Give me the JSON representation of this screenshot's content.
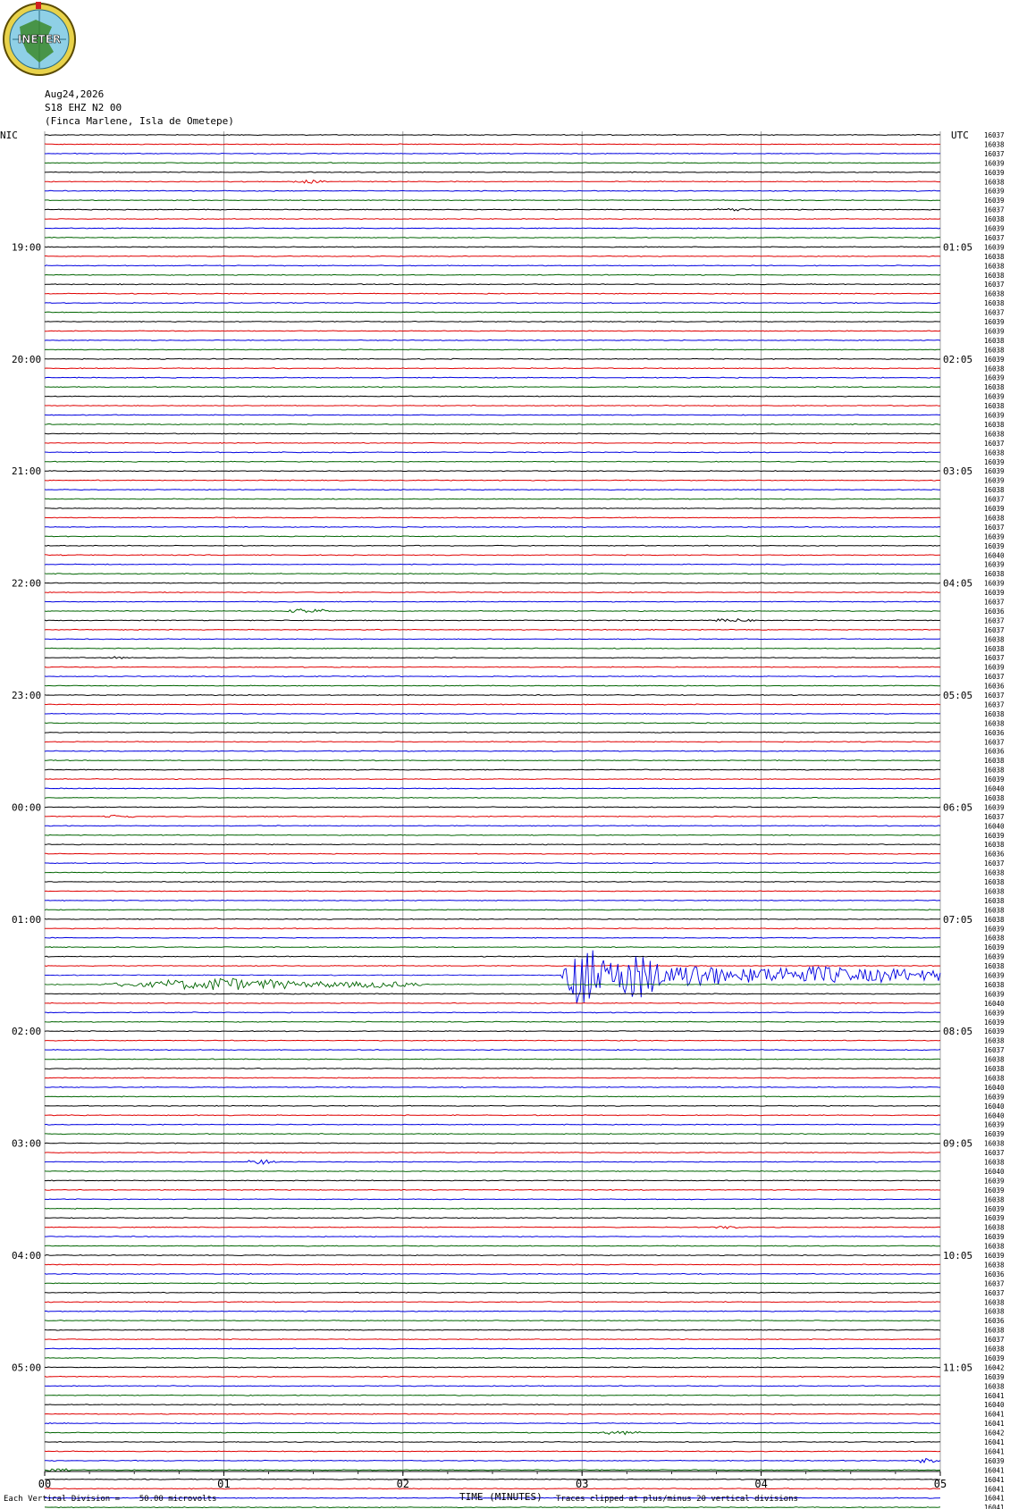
{
  "header": {
    "logo_text": "INETER",
    "date": "Aug24,2026",
    "station": "S18 EHZ N2 00",
    "location": "(Finca Marlene, Isla de Ometepe)"
  },
  "footer": {
    "scale_note": "Each Vertical Division =    50.00 microvolts",
    "axis_title": "TIME (MINUTES)",
    "clip_note": "Traces clipped at plus/minus 20 vertical divisions"
  },
  "colors": {
    "black": "#000000",
    "red": "#e00000",
    "blue": "#0000e0",
    "green": "#006400",
    "grid": "#8a8a8a"
  },
  "chart_data": {
    "type": "line",
    "title": "",
    "xlabel": "TIME (MINUTES)",
    "ylabel": "",
    "xlim": [
      0,
      5
    ],
    "x_ticks": [
      "00",
      "01",
      "02",
      "03",
      "04",
      "05"
    ],
    "grid": true,
    "left_axis_label": "NIC",
    "right_axis_label": "UTC",
    "trace_color_cycle": [
      "black",
      "red",
      "blue",
      "green"
    ],
    "left_hour_labels": [
      "19:00",
      "20:00",
      "21:00",
      "22:00",
      "23:00",
      "00:00",
      "01:00",
      "02:00",
      "03:00",
      "04:00",
      "05:00"
    ],
    "right_hour_labels": [
      "01:05",
      "02:05",
      "03:05",
      "04:05",
      "05:05",
      "06:05",
      "07:05",
      "08:05",
      "09:05",
      "10:05",
      "11:05"
    ],
    "hour_label_trace_index": [
      12,
      24,
      36,
      48,
      60,
      72,
      84,
      96,
      108,
      120,
      132
    ],
    "trace_values": [
      "16037",
      "16038",
      "16037",
      "16039",
      "16039",
      "16038",
      "16039",
      "16039",
      "16037",
      "16038",
      "16039",
      "16037",
      "16039",
      "16038",
      "16038",
      "16038",
      "16037",
      "16038",
      "16038",
      "16037",
      "16039",
      "16039",
      "16038",
      "16038",
      "16039",
      "16038",
      "16039",
      "16038",
      "16039",
      "16038",
      "16039",
      "16038",
      "16038",
      "16037",
      "16038",
      "16039",
      "16039",
      "16039",
      "16038",
      "16037",
      "16039",
      "16038",
      "16037",
      "16039",
      "16039",
      "16040",
      "16039",
      "16038",
      "16039",
      "16039",
      "16037",
      "16036",
      "16037",
      "16037",
      "16038",
      "16038",
      "16037",
      "16039",
      "16037",
      "16036",
      "16037",
      "16037",
      "16038",
      "16038",
      "16036",
      "16037",
      "16036",
      "16038",
      "16038",
      "16039",
      "16040",
      "16038",
      "16039",
      "16037",
      "16040",
      "16039",
      "16038",
      "16036",
      "16037",
      "16038",
      "16038",
      "16038",
      "16038",
      "16038",
      "16038",
      "16039",
      "16038",
      "16039",
      "16039",
      "16038",
      "16039",
      "16038",
      "16039",
      "16040",
      "16039",
      "16039",
      "16039",
      "16038",
      "16037",
      "16038",
      "16038",
      "16038",
      "16040",
      "16039",
      "16040",
      "16040",
      "16039",
      "16039",
      "16038",
      "16037",
      "16038",
      "16040",
      "16039",
      "16039",
      "16038",
      "16039",
      "16039",
      "16038",
      "16039",
      "16038",
      "16039",
      "16038",
      "16036",
      "16037",
      "16037",
      "16038",
      "16038",
      "16036",
      "16038",
      "16037",
      "16038",
      "16039",
      "16042",
      "16039",
      "16038",
      "16041",
      "16040",
      "16041",
      "16041",
      "16042",
      "16041",
      "16041",
      "16039",
      "16041",
      "16041",
      "16041",
      "16041",
      "16041",
      "16041"
    ],
    "events": [
      {
        "trace": 5,
        "start_min": 1.35,
        "end_min": 1.6,
        "amp": 0.3
      },
      {
        "trace": 8,
        "start_min": 3.72,
        "end_min": 3.98,
        "amp": 0.25
      },
      {
        "trace": 51,
        "start_min": 1.33,
        "end_min": 1.62,
        "amp": 0.45
      },
      {
        "trace": 52,
        "start_min": 3.69,
        "end_min": 3.98,
        "amp": 0.3
      },
      {
        "trace": 56,
        "start_min": 0.33,
        "end_min": 0.48,
        "amp": 0.2
      },
      {
        "trace": 73,
        "start_min": 0.32,
        "end_min": 0.52,
        "amp": 0.3
      },
      {
        "trace": 110,
        "start_min": 1.1,
        "end_min": 1.32,
        "amp": 0.45
      },
      {
        "trace": 117,
        "start_min": 3.72,
        "end_min": 3.92,
        "amp": 0.25
      },
      {
        "trace": 139,
        "start_min": 3.05,
        "end_min": 3.38,
        "amp": 0.3
      },
      {
        "trace": 142,
        "start_min": 4.85,
        "end_min": 5.0,
        "amp": 0.45
      },
      {
        "trace": 143,
        "start_min": 0.0,
        "end_min": 0.15,
        "amp": 0.3
      }
    ],
    "quake": {
      "trace": 91,
      "start_min": 0.25,
      "peak_min": 1.0,
      "end_min": 2.1,
      "amp": 1.2
    },
    "quake2": {
      "trace": 90,
      "start_min": 2.88,
      "peak_min": 3.0,
      "end_min": 5.0,
      "amp": 5.5
    }
  }
}
